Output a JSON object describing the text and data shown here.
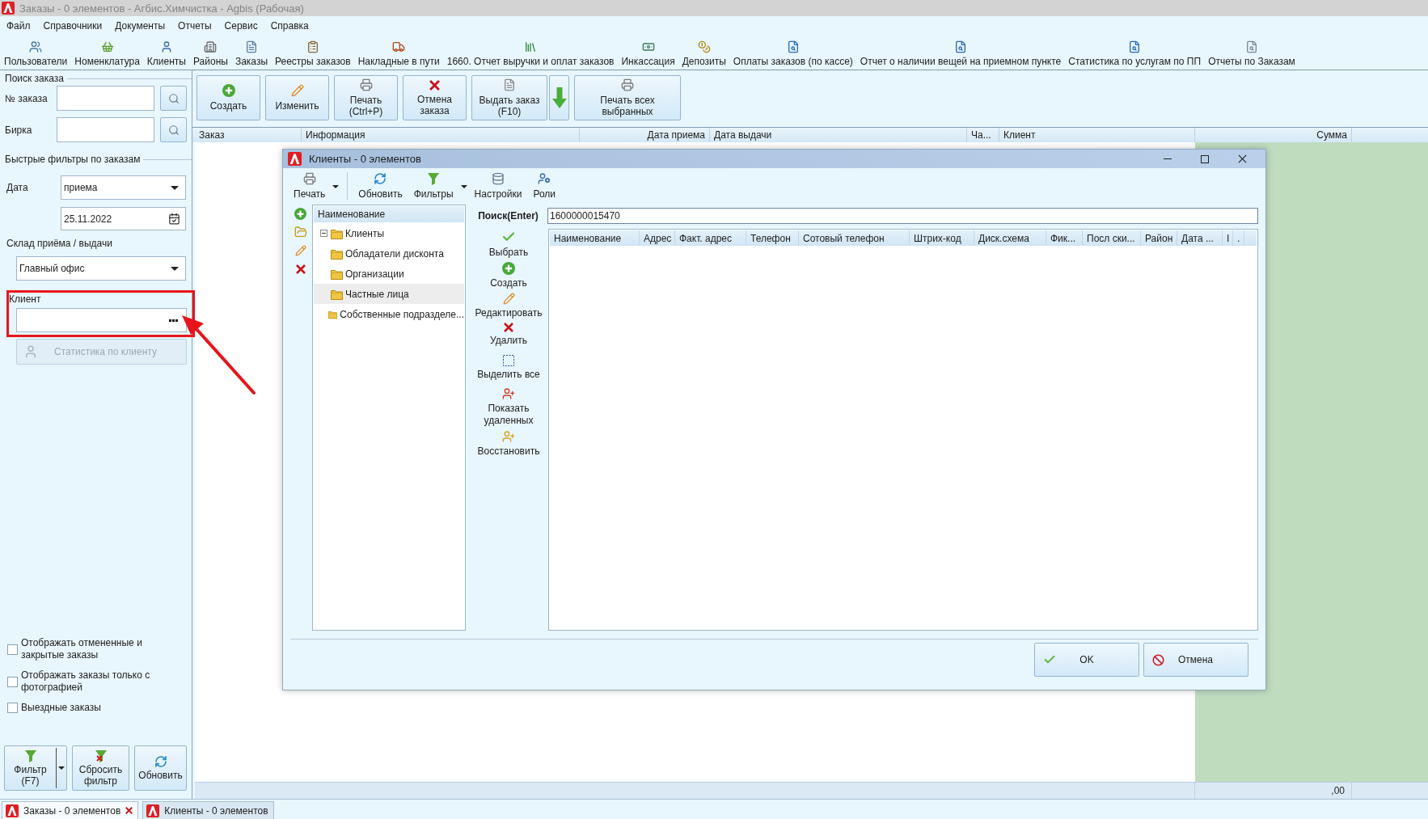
{
  "window": {
    "title": "Заказы - 0 элементов - Агбис.Химчистка - Agbis (Рабочая)"
  },
  "menu": [
    "Файл",
    "Справочники",
    "Документы",
    "Отчеты",
    "Сервис",
    "Справка"
  ],
  "toolbar": [
    "Пользователи",
    "Номенклатура",
    "Клиенты",
    "Районы",
    "Заказы",
    "Реестры заказов",
    "Накладные в пути",
    "1660. Отчет выручки и оплат заказов",
    "Инкассация",
    "Депозиты",
    "Оплаты заказов (по кассе)",
    "Отчет о наличии вещей на приемном пункте",
    "Статистика по услугам по ПП",
    "Отчеты по Заказам"
  ],
  "order_search": {
    "title": "Поиск заказа",
    "fields": [
      {
        "label": "№ заказа"
      },
      {
        "label": "Бирка"
      }
    ]
  },
  "quick_filters": {
    "title": "Быстрые фильтры по заказам",
    "date": {
      "label": "Дата",
      "type": "приема",
      "value": "25.11.2022"
    },
    "warehouse": {
      "label": "Склад приёма / выдачи",
      "value": "Главный офис"
    },
    "client": {
      "label": "Клиент"
    },
    "stats_button": {
      "label": "Статистика по клиенту",
      "disabled": true
    },
    "checkboxes": [
      {
        "label": "Отображать отмененные и закрытые заказы",
        "checked": false
      },
      {
        "label": "Отображать заказы только с фотографией",
        "checked": false
      },
      {
        "label": "Выездные заказы",
        "checked": false
      }
    ],
    "buttons": [
      {
        "label": "Фильтр (F7)",
        "dropdown": true
      },
      {
        "label": "Сбросить фильтр",
        "dropdown": false
      },
      {
        "label": "Обновить",
        "dropdown": false
      }
    ]
  },
  "actions": [
    {
      "label": "Создать",
      "arrow": false
    },
    {
      "label": "Изменить",
      "arrow": false
    },
    {
      "label": "Печать (Ctrl+P)",
      "arrow": false
    },
    {
      "label": "Отмена заказа",
      "arrow": false
    },
    {
      "label": "Выдать заказ (F10)",
      "arrow": true
    },
    {
      "label": "Печать всех выбранных",
      "arrow": false
    }
  ],
  "orders_table": {
    "columns": [
      "Заказ",
      "Информация",
      "Дата приема",
      "Дата выдачи",
      "Ча...",
      "Клиент",
      "Сумма"
    ],
    "total": ",00"
  },
  "dialog": {
    "title": "Клиенты - 0 элементов",
    "toolbar": [
      {
        "label": "Печать",
        "dropdown": true
      },
      {
        "label": "Обновить",
        "dropdown": false
      },
      {
        "label": "Фильтры",
        "dropdown": true
      },
      {
        "label": "Настройки",
        "dropdown": false
      },
      {
        "label": "Роли",
        "dropdown": false
      }
    ],
    "tree": {
      "header": "Наименование",
      "items": [
        {
          "label": "Клиенты",
          "expanded": true,
          "selected": false,
          "children": [
            {
              "label": "Обладатели дисконта",
              "selected": false
            },
            {
              "label": "Организации",
              "selected": false
            },
            {
              "label": "Частные лица",
              "selected": true
            }
          ]
        },
        {
          "label": "Собственные подразделе...",
          "selected": false
        }
      ]
    },
    "search_label": "Поиск(Enter)",
    "search_value": "1600000015470",
    "side_actions": [
      "Выбрать",
      "Создать",
      "Редактировать",
      "Удалить",
      "Выделить все",
      "Показать удаленных",
      "Восстановить"
    ],
    "grid_columns": [
      "Наименование",
      "Адрес",
      "Факт. адрес",
      "Телефон",
      "Сотовый телефон",
      "Штрих-код",
      "Диск.схема",
      "Фик...",
      "Посл ски...",
      "Район",
      "Дата ...",
      "I",
      "."
    ],
    "buttons": [
      "OK",
      "Отмена"
    ]
  },
  "taskbar": [
    {
      "label": "Заказы - 0 элементов",
      "selected": true,
      "closable": true
    },
    {
      "label": "Клиенты - 0 элементов",
      "selected": false,
      "closable": false
    }
  ]
}
